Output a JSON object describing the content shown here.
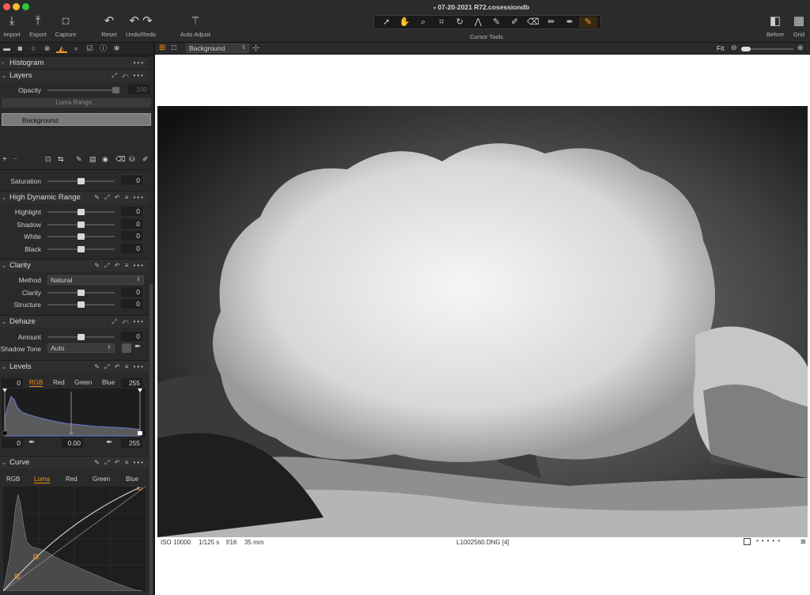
{
  "window": {
    "title": "07-20-2021 R72.cosessiondb"
  },
  "toolbar": {
    "import": "Import",
    "export": "Export",
    "capture": "Capture",
    "reset": "Reset",
    "undo_redo": "Undo/Redo",
    "auto_adjust": "Auto Adjust",
    "cursor_tools": "Cursor Tools",
    "before": "Before",
    "grid": "Grid"
  },
  "cursor_tools": [
    {
      "icon": "pointer-icon"
    },
    {
      "icon": "pan-hand-icon"
    },
    {
      "icon": "loupe-icon"
    },
    {
      "icon": "crop-icon"
    },
    {
      "icon": "rotate-icon"
    },
    {
      "icon": "keystone-icon"
    },
    {
      "icon": "brush-icon"
    },
    {
      "icon": "erase-icon"
    },
    {
      "icon": "gradient-icon"
    },
    {
      "icon": "linear-mask-icon"
    },
    {
      "icon": "color-picker-icon"
    },
    {
      "icon": "annotate-icon"
    }
  ],
  "histogram": {
    "title": "Histogram"
  },
  "layers": {
    "title": "Layers",
    "opacity_label": "Opacity",
    "opacity_value": "100",
    "luma_range_label": "Luma Range...",
    "layer_name": "Background"
  },
  "saturation": {
    "label": "Saturation",
    "value": "0"
  },
  "hdr": {
    "title": "High Dynamic Range",
    "rows": [
      {
        "label": "Highlight",
        "value": "0"
      },
      {
        "label": "Shadow",
        "value": "0"
      },
      {
        "label": "White",
        "value": "0"
      },
      {
        "label": "Black",
        "value": "0"
      }
    ]
  },
  "clarity": {
    "title": "Clarity",
    "method_label": "Method",
    "method_value": "Natural",
    "clarity_label": "Clarity",
    "clarity_value": "0",
    "structure_label": "Structure",
    "structure_value": "0"
  },
  "dehaze": {
    "title": "Dehaze",
    "amount_label": "Amount",
    "amount_value": "0",
    "shadow_tone_label": "Shadow Tone",
    "shadow_tone_value": "Auto"
  },
  "levels": {
    "title": "Levels",
    "tabs": [
      "RGB",
      "Red",
      "Green",
      "Blue"
    ],
    "input_low": "0",
    "input_high": "255",
    "output_low": "0",
    "midtone": "0.00",
    "output_high": "255"
  },
  "curve": {
    "title": "Curve",
    "tabs": [
      "RGB",
      "Luma",
      "Red",
      "Green",
      "Blue"
    ]
  },
  "viewer": {
    "layer_select": "Background",
    "fit_label": "Fit",
    "iso": "ISO 10000",
    "shutter": "1/125 s",
    "aperture": "f/16",
    "focal": "35 mm",
    "filename": "L1002560.DNG [4]"
  },
  "colors": {
    "accent": "#f09020",
    "panel": "#2a2a2a",
    "titlebar": "#2b2b2b"
  }
}
